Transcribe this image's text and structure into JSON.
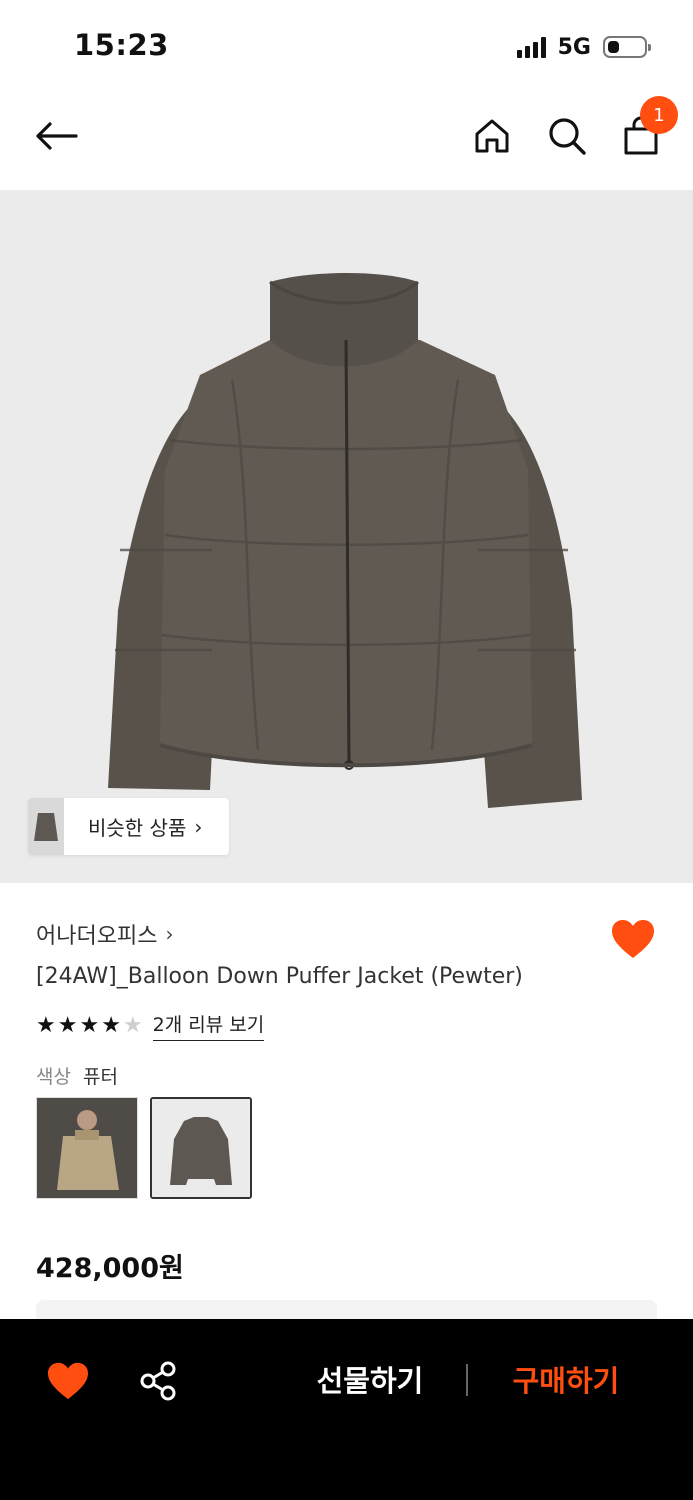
{
  "status_bar": {
    "time": "15:23",
    "network": "5G",
    "battery_level": 0.3
  },
  "nav": {
    "cart_count": "1",
    "icons": [
      "back-arrow-icon",
      "home-icon",
      "search-icon",
      "cart-icon"
    ]
  },
  "product": {
    "similar_label": "비슷한 상품",
    "brand": "어나더오피스",
    "title": "[24AW]_Balloon Down Puffer Jacket (Pewter)",
    "rating": 4,
    "rating_max": 5,
    "review_link": "2개 리뷰 보기",
    "color_label": "색상",
    "color_value": "퓨터",
    "price": "428,000원",
    "wishlisted": true
  },
  "bottom_bar": {
    "gift_label": "선물하기",
    "buy_label": "구매하기"
  },
  "colors": {
    "accent": "#ff4e10",
    "text": "#111111",
    "image_bg": "#ebebeb",
    "bar_bg": "#000000"
  }
}
